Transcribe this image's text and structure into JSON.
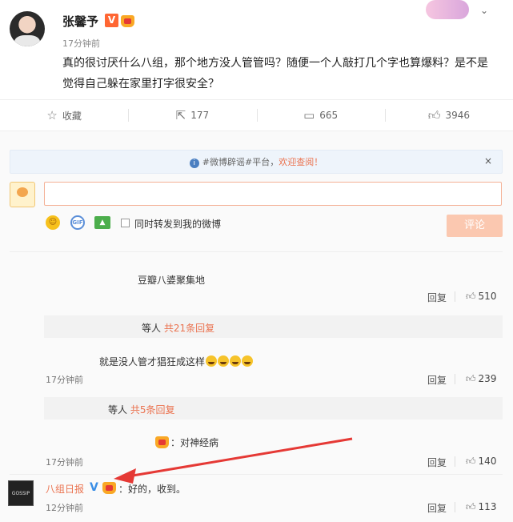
{
  "post": {
    "author": "张馨予",
    "verified_badge": "V",
    "time": "17分钟前",
    "text": "真的很讨厌什么八组，那个地方没人管管吗？随便一个人敲打几个字也算爆料？是不是觉得自己躲在家里打字很安全？"
  },
  "actions": {
    "favorite_label": "收藏",
    "repost_count": "177",
    "comment_count": "665",
    "like_count": "3946"
  },
  "notice": {
    "prefix": "#微博辟谣#平台，",
    "link": "欢迎查阅！",
    "close": "×"
  },
  "composer": {
    "repost_label": "同时转发到我的微博",
    "submit_label": "评论",
    "gif_label": "GIF"
  },
  "comments": [
    {
      "text": "豆瓣八婆聚集地",
      "reply_label": "回复",
      "likes": "510",
      "subreply_prefix": "等人",
      "subreply_link": "共21条回复"
    },
    {
      "text": "就是没人管才猖狂成这样",
      "time": "17分钟前",
      "reply_label": "回复",
      "likes": "239",
      "subreply_prefix": "等人",
      "subreply_link": "共5条回复"
    },
    {
      "text": "：对神经病",
      "time": "17分钟前",
      "reply_label": "回复",
      "likes": "140"
    },
    {
      "author": "八组日报",
      "verified_badge": "V",
      "text": "：好的，收到。",
      "time": "12分钟前",
      "reply_label": "回复",
      "likes": "113",
      "avatar_text": "GOSSIP"
    }
  ],
  "colors": {
    "accent": "#eb7350",
    "arrow": "#e53935",
    "notice_bg": "#eef4fb"
  }
}
